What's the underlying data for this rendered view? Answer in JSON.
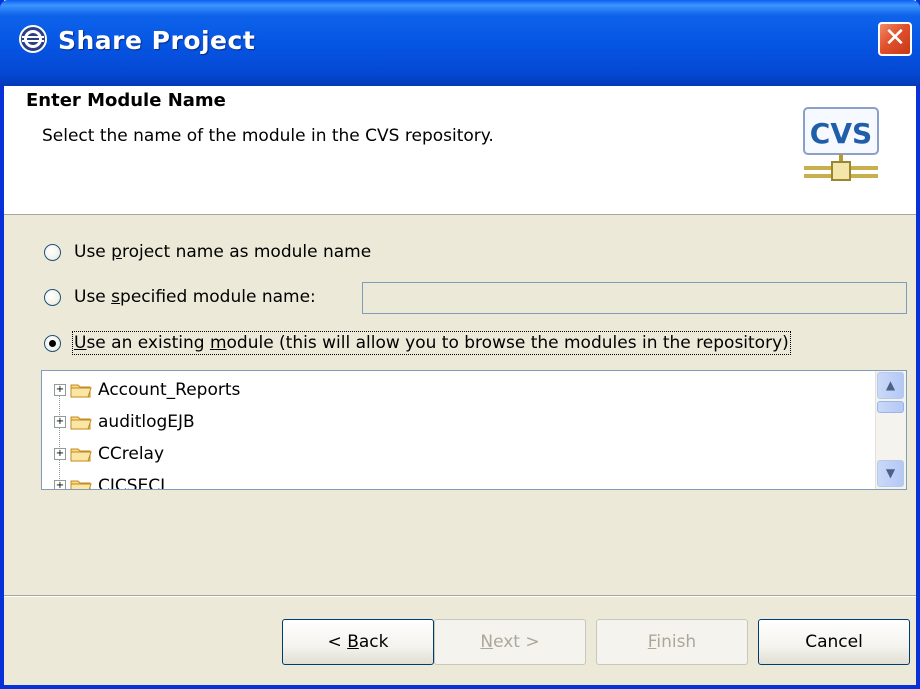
{
  "window": {
    "title": "Share Project",
    "close_label": "✕"
  },
  "header": {
    "title": "Enter Module Name",
    "description": "Select the name of the module in the CVS repository.",
    "logo_text": "CVS"
  },
  "options": [
    {
      "prefix": "Use ",
      "mnemonic": "p",
      "suffix": "roject name as module name",
      "checked": false
    },
    {
      "prefix": "Use ",
      "mnemonic": "s",
      "suffix": "pecified module name:",
      "checked": false
    },
    {
      "prefix": "",
      "mnemonic": "U",
      "suffix": "se an existing ",
      "mnemonic2": "m",
      "suffix2": "odule (this will allow you to browse the modules in the repository)",
      "checked": true
    }
  ],
  "module_name_field": {
    "value": "",
    "placeholder": ""
  },
  "tree": {
    "items": [
      "Account_Reports",
      "auditlogEJB",
      "CCrelay",
      "CICSECI"
    ]
  },
  "buttons": {
    "back_prefix": "< ",
    "back_mnemonic": "B",
    "back_suffix": "ack",
    "next_mnemonic": "N",
    "next_suffix": "ext >",
    "finish_mnemonic": "F",
    "finish_suffix": "inish",
    "cancel": "Cancel"
  },
  "colors": {
    "titlebar": "#0656e4",
    "dialog_bg": "#ece9d8",
    "close": "#e0512b"
  }
}
